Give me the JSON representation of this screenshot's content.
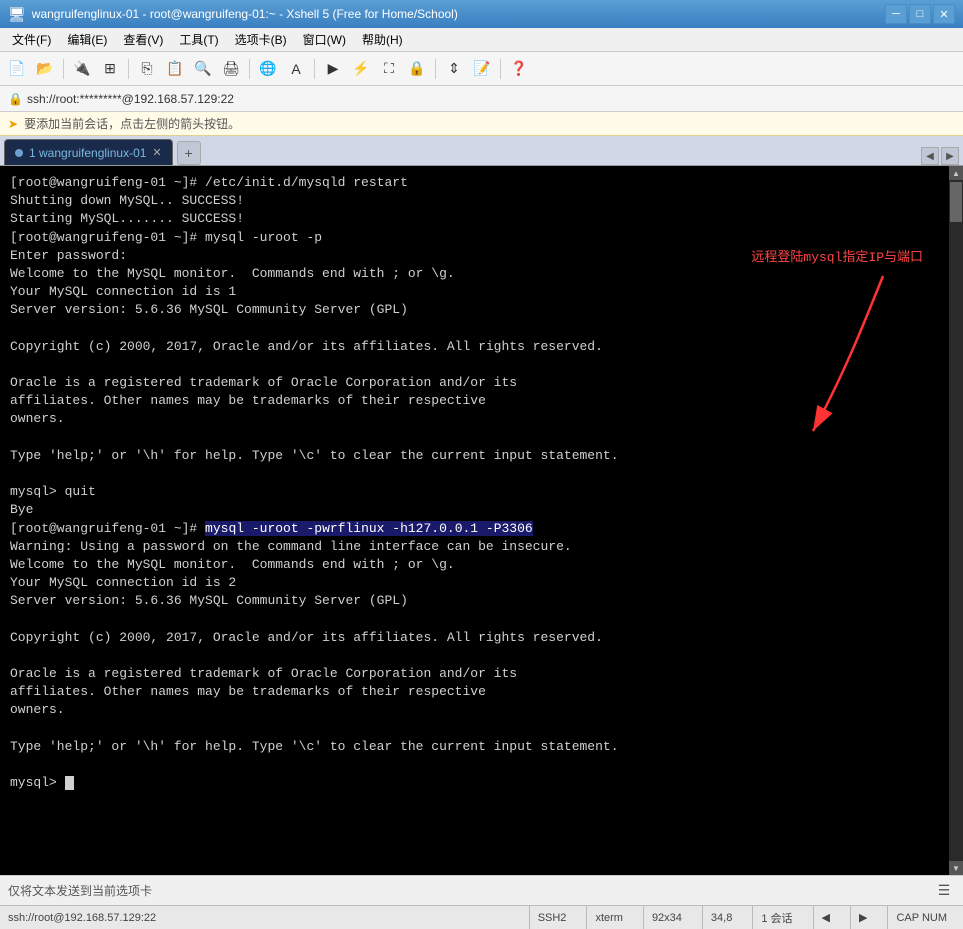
{
  "window": {
    "title": "wangruifenglinux-01 - root@wangruifeng-01:~ - Xshell 5 (Free for Home/School)",
    "tab_label": "1 wangruifenglinux-01"
  },
  "menu": {
    "items": [
      "文件(F)",
      "编辑(E)",
      "查看(V)",
      "工具(T)",
      "选项卡(B)",
      "窗口(W)",
      "帮助(H)"
    ]
  },
  "address_bar": {
    "text": "ssh://root:*********@192.168.57.129:22"
  },
  "info_bar": {
    "text": "要添加当前会话，点击左侧的箭头按钮。"
  },
  "terminal": {
    "line1": "[root@wangruifeng-01 ~]# /etc/init.d/mysqld restart",
    "line2": "Shutting down MySQL.. SUCCESS!",
    "line3": "Starting MySQL....... SUCCESS!",
    "line4": "[root@wangruifeng-01 ~]# mysql -uroot -p",
    "line5": "Enter password:",
    "line6": "Welcome to the MySQL monitor.  Commands end with ; or \\g.",
    "line7": "Your MySQL connection id is 1",
    "line8": "Server version: 5.6.36 MySQL Community Server (GPL)",
    "line9": "",
    "line10": "Copyright (c) 2000, 2017, Oracle and/or its affiliates. All rights reserved.",
    "line11": "",
    "line12": "Oracle is a registered trademark of Oracle Corporation and/or its",
    "line13": "affiliates. Other names may be trademarks of their respective",
    "line14": "owners.",
    "line15": "",
    "line16": "Type 'help;' or '\\h' for help. Type '\\c' to clear the current input statement.",
    "line17": "",
    "line18": "mysql> quit",
    "line19": "Bye",
    "line20": "[root@wangruifeng-01 ~]# ",
    "cmd_highlight": "mysql -uroot -pwrflinux -h127.0.0.1 -P3306",
    "line21": "",
    "line22": "Warning: Using a password on the command line interface can be insecure.",
    "line23": "Welcome to the MySQL monitor.  Commands end with ; or \\g.",
    "line24": "Your MySQL connection id is 2",
    "line25": "Server version: 5.6.36 MySQL Community Server (GPL)",
    "line26": "",
    "line27": "Copyright (c) 2000, 2017, Oracle and/or its affiliates. All rights reserved.",
    "line28": "",
    "line29": "Oracle is a registered trademark of Oracle Corporation and/or its",
    "line30": "affiliates. Other names may be trademarks of their respective",
    "line31": "owners.",
    "line32": "",
    "line33": "Type 'help;' or '\\h' for help. Type '\\c' to clear the current input statement.",
    "line34": "",
    "line35": "mysql> "
  },
  "annotation": {
    "text": "远程登陆mysql指定IP与端口"
  },
  "bottom_toolbar": {
    "send_label": "仅将文本发送到当前选项卡"
  },
  "status_bar": {
    "address": "ssh://root@192.168.57.129:22",
    "protocol": "SSH2",
    "encoding": "xterm",
    "terminal_size": "92x34",
    "cursor_pos": "34,8",
    "sessions": "1 会话",
    "caps": "CAP NUM"
  }
}
